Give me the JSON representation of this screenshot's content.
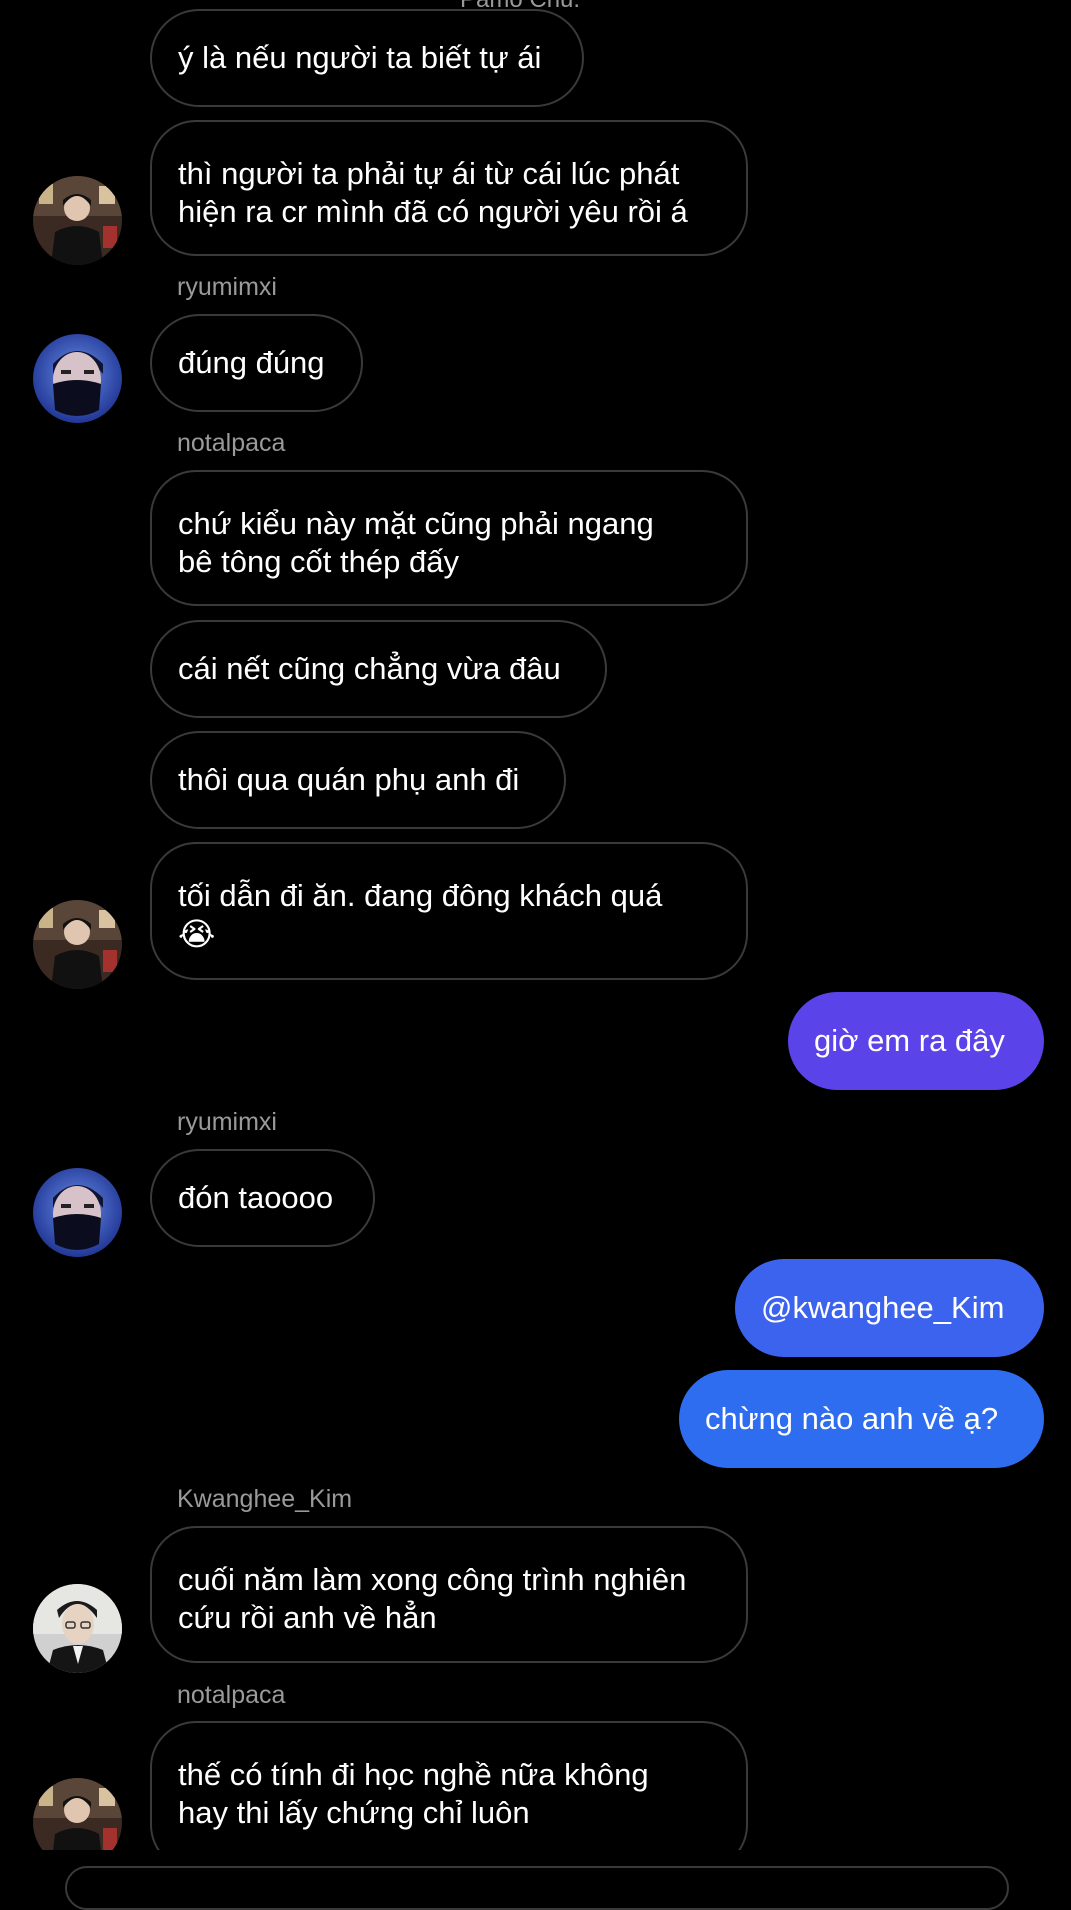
{
  "top_partial_name": "Pamo Chu.",
  "messages": [
    {
      "text": "ý là nếu người ta biết tự ái"
    },
    {
      "text": "thì người ta phải tự ái từ cái lúc phát\nhiện ra cr mình đã có người yêu rồi á"
    },
    {
      "sender": "ryumimxi",
      "text": "đúng đúng"
    },
    {
      "sender": "notalpaca",
      "text": "chứ kiểu này mặt cũng phải ngang\nbê tông cốt thép đấy"
    },
    {
      "text": "cái nết cũng chẳng vừa đâu"
    },
    {
      "text": "thôi qua quán phụ anh đi"
    },
    {
      "text": "tối dẫn đi ăn. đang đông khách quá",
      "emoji": "😭"
    },
    {
      "text": "giờ em ra đây"
    },
    {
      "sender": "ryumimxi",
      "text": "đón taoooo"
    },
    {
      "text": "@kwanghee_Kim"
    },
    {
      "text": "chừng nào anh về ạ?"
    },
    {
      "sender": "Kwanghee_Kim",
      "text": "cuối năm làm xong công trình nghiên\ncứu rồi anh về hẳn"
    },
    {
      "sender": "notalpaca",
      "text": "thế có tính đi học nghề nữa không\nhay thi lấy chứng chỉ luôn"
    }
  ],
  "colors": {
    "outgoing_top": "#5a43e8",
    "outgoing_mid": "#3c63ee",
    "outgoing_bottom": "#2f6df0",
    "incoming_border": "#3a3a3a",
    "username": "#9a9a9a"
  },
  "icons": {
    "avatar_notalpaca": "person-photo",
    "avatar_ryumimxi": "masked-person-photo",
    "avatar_kwanghee": "person-photo"
  }
}
